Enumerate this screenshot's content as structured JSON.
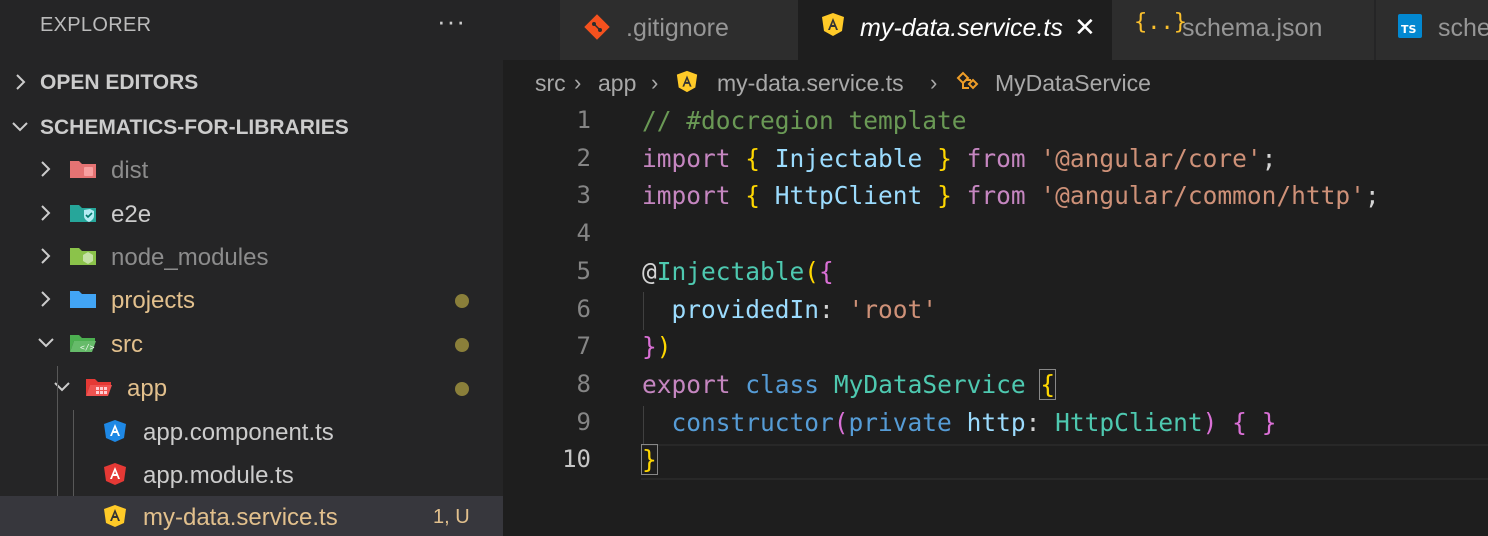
{
  "explorer": {
    "title": "EXPLORER",
    "more": "···",
    "sections": [
      {
        "label": "OPEN EDITORS"
      },
      {
        "label": "SCHEMATICS-FOR-LIBRARIES"
      }
    ],
    "tree": [
      {
        "name": "dist"
      },
      {
        "name": "e2e"
      },
      {
        "name": "node_modules"
      },
      {
        "name": "projects"
      },
      {
        "name": "src"
      },
      {
        "name": "app"
      },
      {
        "name": "app.component.ts"
      },
      {
        "name": "app.module.ts"
      },
      {
        "name": "my-data.service.ts",
        "status": "1, U"
      }
    ]
  },
  "tabs": [
    {
      "label": ".gitignore"
    },
    {
      "label": "my-data.service.ts",
      "close": "✕"
    },
    {
      "label": "schema.json"
    },
    {
      "label": "schema.ts"
    }
  ],
  "breadcrumb": {
    "items": [
      "src",
      "app",
      "my-data.service.ts",
      "MyDataService"
    ],
    "sep": "›"
  },
  "editor": {
    "line_numbers": [
      "1",
      "2",
      "3",
      "4",
      "5",
      "6",
      "7",
      "8",
      "9",
      "10"
    ],
    "lines": [
      {
        "tokens": [
          [
            "// #docregion template",
            "comment"
          ]
        ]
      },
      {
        "tokens": [
          [
            "import",
            "kw"
          ],
          [
            " ",
            "plain"
          ],
          [
            "{",
            "br1"
          ],
          [
            " Injectable ",
            "var"
          ],
          [
            "}",
            "br1"
          ],
          [
            " from ",
            "kw"
          ],
          [
            "'@angular/core'",
            "str"
          ],
          [
            ";",
            "plain"
          ]
        ]
      },
      {
        "tokens": [
          [
            "import",
            "kw"
          ],
          [
            " ",
            "plain"
          ],
          [
            "{",
            "br1"
          ],
          [
            " HttpClient ",
            "var"
          ],
          [
            "}",
            "br1"
          ],
          [
            " from ",
            "kw"
          ],
          [
            "'@angular/common/http'",
            "str"
          ],
          [
            ";",
            "plain"
          ]
        ]
      },
      {
        "tokens": []
      },
      {
        "tokens": [
          [
            "@",
            "plain"
          ],
          [
            "Injectable",
            "type"
          ],
          [
            "(",
            "br1"
          ],
          [
            "{",
            "br2"
          ]
        ]
      },
      {
        "tokens": [
          [
            "  ",
            "plain"
          ],
          [
            "providedIn",
            "var"
          ],
          [
            ": ",
            "plain"
          ],
          [
            "'root'",
            "str"
          ]
        ]
      },
      {
        "tokens": [
          [
            "}",
            "br2"
          ],
          [
            ")",
            "br1"
          ]
        ]
      },
      {
        "tokens": [
          [
            "export",
            "kw"
          ],
          [
            " ",
            "plain"
          ],
          [
            "class",
            "kw2"
          ],
          [
            " ",
            "plain"
          ],
          [
            "MyDataService",
            "type"
          ],
          [
            " ",
            "plain"
          ],
          [
            "{",
            "br1"
          ]
        ]
      },
      {
        "tokens": [
          [
            "  ",
            "plain"
          ],
          [
            "constructor",
            "kw2"
          ],
          [
            "(",
            "br2"
          ],
          [
            "private",
            "kw2"
          ],
          [
            " ",
            "plain"
          ],
          [
            "http",
            "var"
          ],
          [
            ": ",
            "plain"
          ],
          [
            "HttpClient",
            "type"
          ],
          [
            ")",
            "br2"
          ],
          [
            " ",
            "plain"
          ],
          [
            "{",
            "br2"
          ],
          [
            " ",
            "plain"
          ],
          [
            "}",
            "br2"
          ]
        ]
      },
      {
        "tokens": [
          [
            "}",
            "br1"
          ]
        ]
      }
    ]
  },
  "colors": {
    "accent_yellow": "#e2c08d",
    "angular_red": "#dd0031",
    "angular_blue": "#1e88e5",
    "angular_yellow": "#ffca28"
  }
}
